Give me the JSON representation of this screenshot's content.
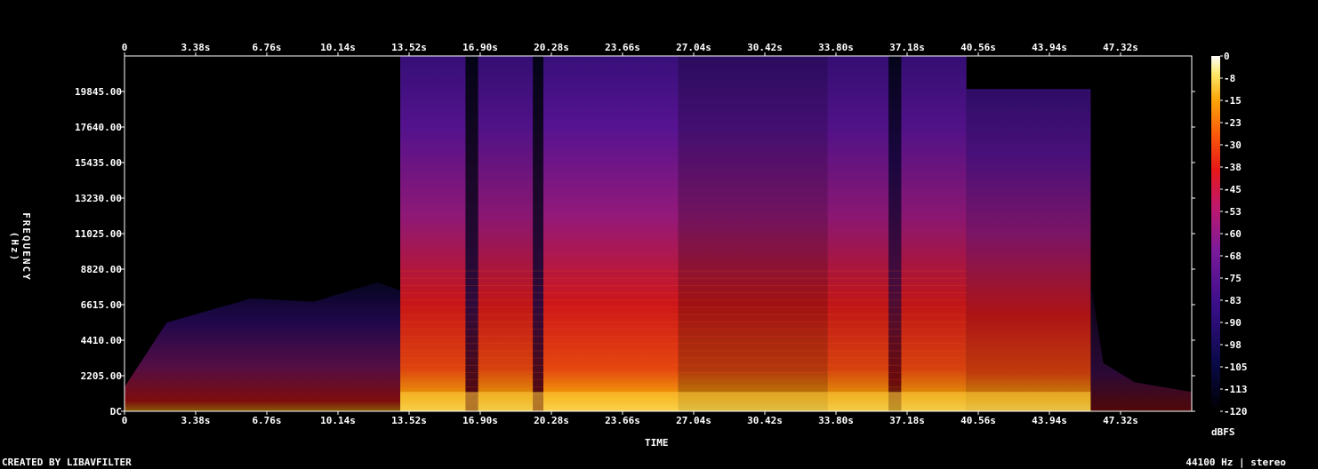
{
  "chart_data": {
    "type": "heatmap",
    "title": "",
    "xlabel": "TIME",
    "ylabel": "FREQUENCY (Hz)",
    "x_ticks": [
      "0",
      "3.38s",
      "6.76s",
      "10.14s",
      "13.52s",
      "16.90s",
      "20.28s",
      "23.66s",
      "27.04s",
      "30.42s",
      "33.80s",
      "37.18s",
      "40.56s",
      "43.94s",
      "47.32s"
    ],
    "x_tick_values": [
      0,
      3.38,
      6.76,
      10.14,
      13.52,
      16.9,
      20.28,
      23.66,
      27.04,
      30.42,
      33.8,
      37.18,
      40.56,
      43.94,
      47.32
    ],
    "xlim": [
      0,
      50.7
    ],
    "y_ticks": [
      "DC",
      "2205.00",
      "4410.00",
      "6615.00",
      "8820.00",
      "11025.00",
      "13230.00",
      "15435.00",
      "17640.00",
      "19845.00"
    ],
    "y_tick_values": [
      0,
      2205,
      4410,
      6615,
      8820,
      11025,
      13230,
      15435,
      17640,
      19845
    ],
    "ylim": [
      0,
      22050
    ],
    "colorbar": {
      "unit": "dBFS",
      "ticks": [
        "0",
        "-8",
        "-15",
        "-23",
        "-30",
        "-38",
        "-45",
        "-53",
        "-60",
        "-68",
        "-75",
        "-83",
        "-90",
        "-98",
        "-105",
        "-113",
        "-120"
      ],
      "range": [
        -120,
        0
      ]
    },
    "segments": [
      {
        "start": 0.0,
        "end": 13.1,
        "top_freq": 7500,
        "level_db": -85
      },
      {
        "start": 13.1,
        "end": 16.2,
        "top_freq": 22050,
        "level_db": -60
      },
      {
        "start": 16.2,
        "end": 16.8,
        "top_freq": 22050,
        "level_db": -95
      },
      {
        "start": 16.8,
        "end": 19.4,
        "top_freq": 22050,
        "level_db": -62
      },
      {
        "start": 19.4,
        "end": 19.9,
        "top_freq": 22050,
        "level_db": -95
      },
      {
        "start": 19.9,
        "end": 26.3,
        "top_freq": 22050,
        "level_db": -58
      },
      {
        "start": 26.3,
        "end": 33.4,
        "top_freq": 22050,
        "level_db": -72
      },
      {
        "start": 33.4,
        "end": 36.3,
        "top_freq": 22050,
        "level_db": -62
      },
      {
        "start": 36.3,
        "end": 36.9,
        "top_freq": 22050,
        "level_db": -90
      },
      {
        "start": 36.9,
        "end": 40.0,
        "top_freq": 22050,
        "level_db": -62
      },
      {
        "start": 40.0,
        "end": 45.9,
        "top_freq": 20000,
        "level_db": -68
      },
      {
        "start": 45.9,
        "end": 50.7,
        "top_freq": 3500,
        "level_db": -100
      }
    ]
  },
  "footer": {
    "left": "CREATED BY LIBAVFILTER",
    "right": "44100 Hz | stereo"
  },
  "colors": {
    "background": "#000000",
    "frame": "#ffffff"
  }
}
